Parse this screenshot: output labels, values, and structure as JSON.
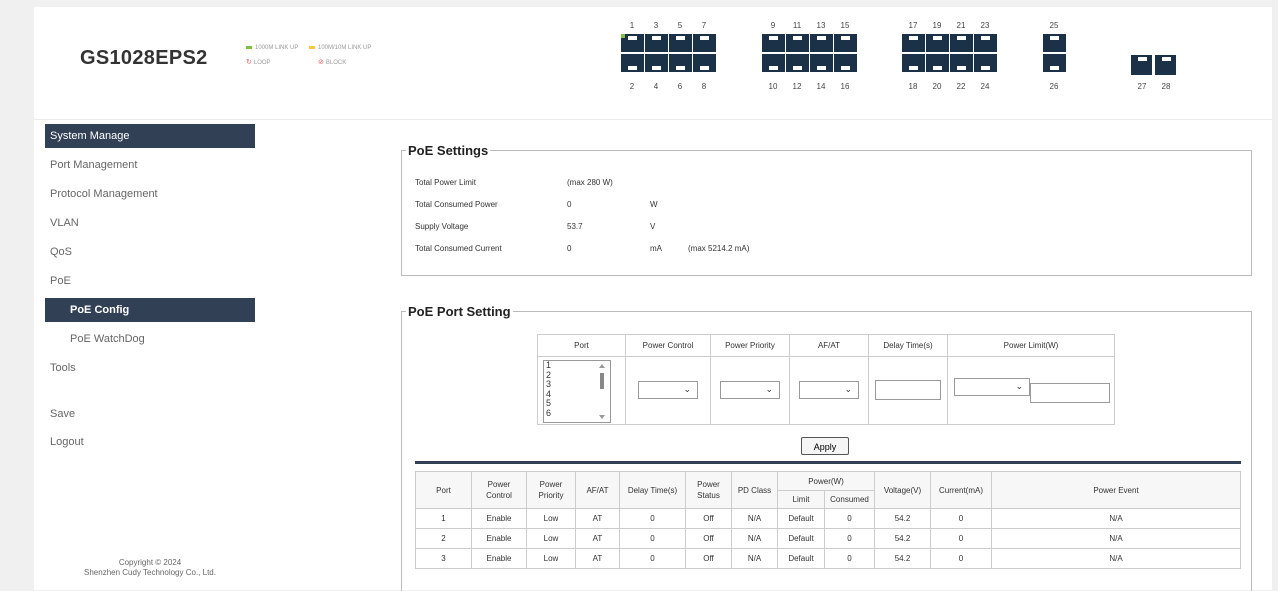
{
  "header": {
    "model": "GS1028EPS2",
    "legend": {
      "link_1000": "1000M LINK UP",
      "link_100": "100M/10M LINK UP",
      "loop": "LOOP",
      "block": "BLOCK",
      "colors": {
        "link_1000": "#7ec242",
        "link_100": "#f5c84a",
        "loop": "#e05c5c",
        "block": "#e05c5c"
      }
    },
    "ports_top": [
      "1",
      "3",
      "5",
      "7",
      "9",
      "11",
      "13",
      "15",
      "17",
      "19",
      "21",
      "23",
      "25",
      "27"
    ],
    "ports_bottom": [
      "2",
      "4",
      "6",
      "8",
      "10",
      "12",
      "14",
      "16",
      "18",
      "20",
      "22",
      "24",
      "26",
      "28"
    ],
    "sfp_ports": [
      "27",
      "28"
    ]
  },
  "sidebar": {
    "items": [
      {
        "label": "System Manage",
        "active": true
      },
      {
        "label": "Port Management"
      },
      {
        "label": "Protocol Management"
      },
      {
        "label": "VLAN"
      },
      {
        "label": "QoS"
      },
      {
        "label": "PoE"
      },
      {
        "label": "PoE Config",
        "sub": true,
        "active": true
      },
      {
        "label": "PoE WatchDog",
        "sub": true
      },
      {
        "label": "Tools"
      },
      {
        "label": "Save"
      },
      {
        "label": "Logout"
      }
    ],
    "copyright_line1": "Copyright © 2024",
    "copyright_line2": "Shenzhen Cudy Technology Co., Ltd."
  },
  "poe_settings": {
    "title": "PoE Settings",
    "rows": [
      {
        "label": "Total Power Limit",
        "value": "(max 280 W)",
        "unit": "",
        "extra": ""
      },
      {
        "label": "Total Consumed Power",
        "value": "0",
        "unit": "W",
        "extra": ""
      },
      {
        "label": "Supply Voltage",
        "value": "53.7",
        "unit": "V",
        "extra": ""
      },
      {
        "label": "Total Consumed Current",
        "value": "0",
        "unit": "mA",
        "extra": "(max 5214.2 mA)"
      }
    ]
  },
  "poe_port_setting": {
    "title": "PoE Port Setting",
    "headers": {
      "port": "Port",
      "power_control": "Power Control",
      "power_priority": "Power Priority",
      "afat": "AF/AT",
      "delay_time": "Delay Time(s)",
      "power_limit": "Power Limit(W)"
    },
    "port_list": [
      "1",
      "2",
      "3",
      "4",
      "5",
      "6"
    ],
    "apply_label": "Apply"
  },
  "port_table": {
    "headers": {
      "port": "Port",
      "power_control": "Power Control",
      "power_priority": "Power Priority",
      "afat": "AF/AT",
      "delay_time": "Delay Time(s)",
      "power_status": "Power Status",
      "pd_class": "PD Class",
      "power_w": "Power(W)",
      "limit": "Limit",
      "consumed": "Consumed",
      "voltage": "Voltage(V)",
      "current": "Current(mA)",
      "power_event": "Power Event"
    },
    "rows": [
      [
        "1",
        "Enable",
        "Low",
        "AT",
        "0",
        "Off",
        "N/A",
        "Default",
        "0",
        "54.2",
        "0",
        "N/A"
      ],
      [
        "2",
        "Enable",
        "Low",
        "AT",
        "0",
        "Off",
        "N/A",
        "Default",
        "0",
        "54.2",
        "0",
        "N/A"
      ],
      [
        "3",
        "Enable",
        "Low",
        "AT",
        "0",
        "Off",
        "N/A",
        "Default",
        "0",
        "54.2",
        "0",
        "N/A"
      ]
    ]
  }
}
